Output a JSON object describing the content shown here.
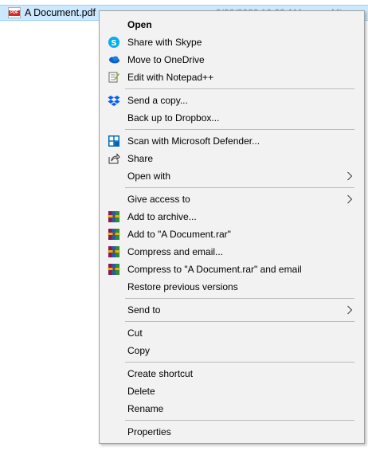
{
  "file": {
    "icon": "pdf-file-icon",
    "icon_label": "PDF",
    "name": "A Document.pdf",
    "date": "9/02/2022 10:22 AM",
    "type": "Micros"
  },
  "menu": {
    "items": [
      {
        "label": "Open",
        "icon": "none"
      },
      {
        "label": "Share with Skype",
        "icon": "skype-icon"
      },
      {
        "label": "Move to OneDrive",
        "icon": "onedrive-icon"
      },
      {
        "label": "Edit with Notepad++",
        "icon": "notepad-plus-plus-icon"
      },
      {
        "label": "Send a copy...",
        "icon": "dropbox-icon"
      },
      {
        "label": "Back up to Dropbox...",
        "icon": "none"
      },
      {
        "label": "Scan with Microsoft Defender...",
        "icon": "defender-icon"
      },
      {
        "label": "Share",
        "icon": "share-icon"
      },
      {
        "label": "Open with",
        "icon": "none",
        "submenu": true
      },
      {
        "label": "Give access to",
        "icon": "none",
        "submenu": true
      },
      {
        "label": "Add to archive...",
        "icon": "winrar-icon"
      },
      {
        "label": "Add to \"A Document.rar\"",
        "icon": "winrar-icon"
      },
      {
        "label": "Compress and email...",
        "icon": "winrar-icon"
      },
      {
        "label": "Compress to \"A Document.rar\" and email",
        "icon": "winrar-icon"
      },
      {
        "label": "Restore previous versions",
        "icon": "none"
      },
      {
        "label": "Send to",
        "icon": "none",
        "submenu": true
      },
      {
        "label": "Cut",
        "icon": "none"
      },
      {
        "label": "Copy",
        "icon": "none"
      },
      {
        "label": "Create shortcut",
        "icon": "none"
      },
      {
        "label": "Delete",
        "icon": "none"
      },
      {
        "label": "Rename",
        "icon": "none"
      },
      {
        "label": "Properties",
        "icon": "none"
      }
    ]
  },
  "colors": {
    "selection": "#cce8ff",
    "menu_bg": "#f2f2f2",
    "skype": "#00aff0",
    "onedrive": "#0a64c8",
    "dropbox": "#0061ff",
    "defender": "#0067b8"
  }
}
